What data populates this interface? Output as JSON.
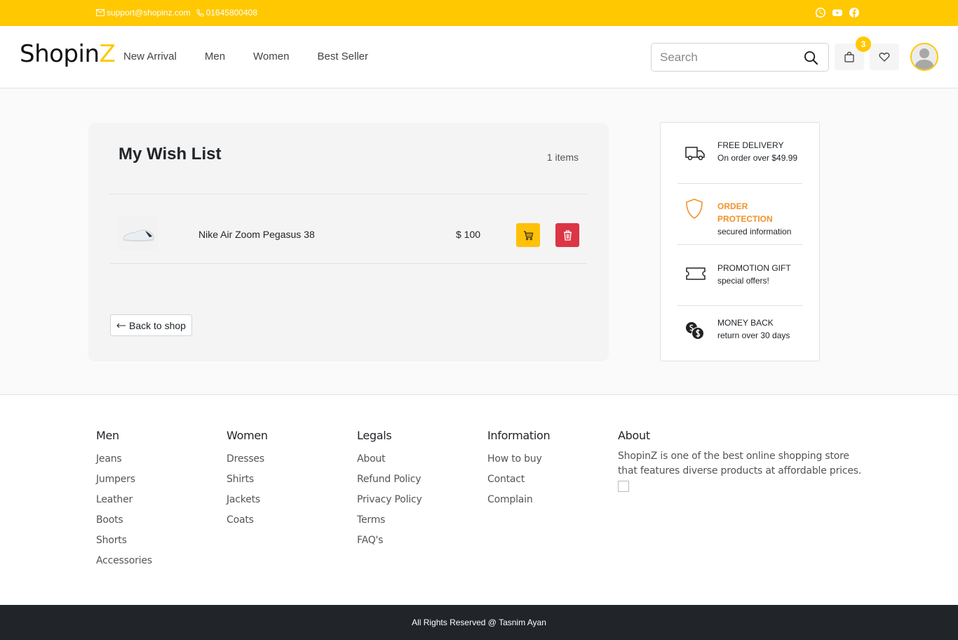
{
  "topbar": {
    "email": "support@shopinz.com",
    "phone": "01645800408",
    "social_icons": [
      "whatsapp-icon",
      "youtube-icon",
      "facebook-icon"
    ]
  },
  "header": {
    "logo_main": "Shopin",
    "logo_accent": "Z",
    "nav": [
      "New Arrival",
      "Men",
      "Women",
      "Best Seller"
    ],
    "search_placeholder": "Search",
    "cart_count": "3"
  },
  "wishlist": {
    "title": "My Wish List",
    "item_count": "1",
    "item_count_label": "items",
    "items": [
      {
        "name": "Nike Air Zoom Pegasus 38",
        "price": "$ 100"
      }
    ],
    "back_label": "Back to shop"
  },
  "features": [
    {
      "title": "FREE DELIVERY",
      "subtitle": "On order over $49.99",
      "icon": "truck-icon",
      "highlight": false
    },
    {
      "title": "ORDER PROTECTION",
      "subtitle": "secured information",
      "icon": "shield-icon",
      "highlight": true
    },
    {
      "title": "PROMOTION GIFT",
      "subtitle": "special offers!",
      "icon": "ticket-icon",
      "highlight": false
    },
    {
      "title": "MONEY BACK",
      "subtitle": "return over 30 days",
      "icon": "coins-icon",
      "highlight": false
    }
  ],
  "footer": {
    "men": {
      "title": "Men",
      "links": [
        "Jeans",
        "Jumpers",
        "Leather",
        "Boots",
        "Shorts",
        "Accessories"
      ]
    },
    "women": {
      "title": "Women",
      "links": [
        "Dresses",
        "Shirts",
        "Jackets",
        "Coats"
      ]
    },
    "legals": {
      "title": "Legals",
      "links": [
        "About",
        "Refund Policy",
        "Privacy Policy",
        "Terms",
        "FAQ's"
      ]
    },
    "information": {
      "title": "Information",
      "links": [
        "How to buy",
        "Contact",
        "Complain"
      ]
    },
    "about": {
      "title": "About",
      "text": "ShopinZ is one of the best online shopping store that features diverse products at affordable prices."
    },
    "copyright": "All Rights Reserved @ Tasnim Ayan"
  },
  "colors": {
    "accent": "#ffc800",
    "danger": "#dc3545",
    "highlight": "#f0932b",
    "dark": "#212529"
  }
}
